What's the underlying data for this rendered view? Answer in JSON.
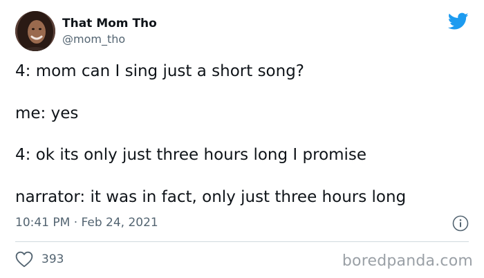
{
  "tweet": {
    "author": {
      "display_name": "That Mom Tho",
      "handle": "@mom_tho",
      "avatar": "profile-photo-avatar"
    },
    "lines": [
      "4: mom can I sing just a short song?",
      "me: yes",
      "4: ok its only just three hours long I promise",
      "narrator: it was in fact, only just three hours long"
    ],
    "timestamp": "10:41 PM · Feb 24, 2021",
    "likes": "393"
  },
  "icons": {
    "platform": "twitter-bird-icon",
    "info": "info-icon",
    "like": "heart-icon"
  },
  "colors": {
    "twitter_blue": "#1d9bf0",
    "text": "#0f1419",
    "secondary_text": "#536471",
    "divider": "#cfd9de",
    "watermark": "#9aa0a6"
  },
  "watermark": "boredpanda.com"
}
